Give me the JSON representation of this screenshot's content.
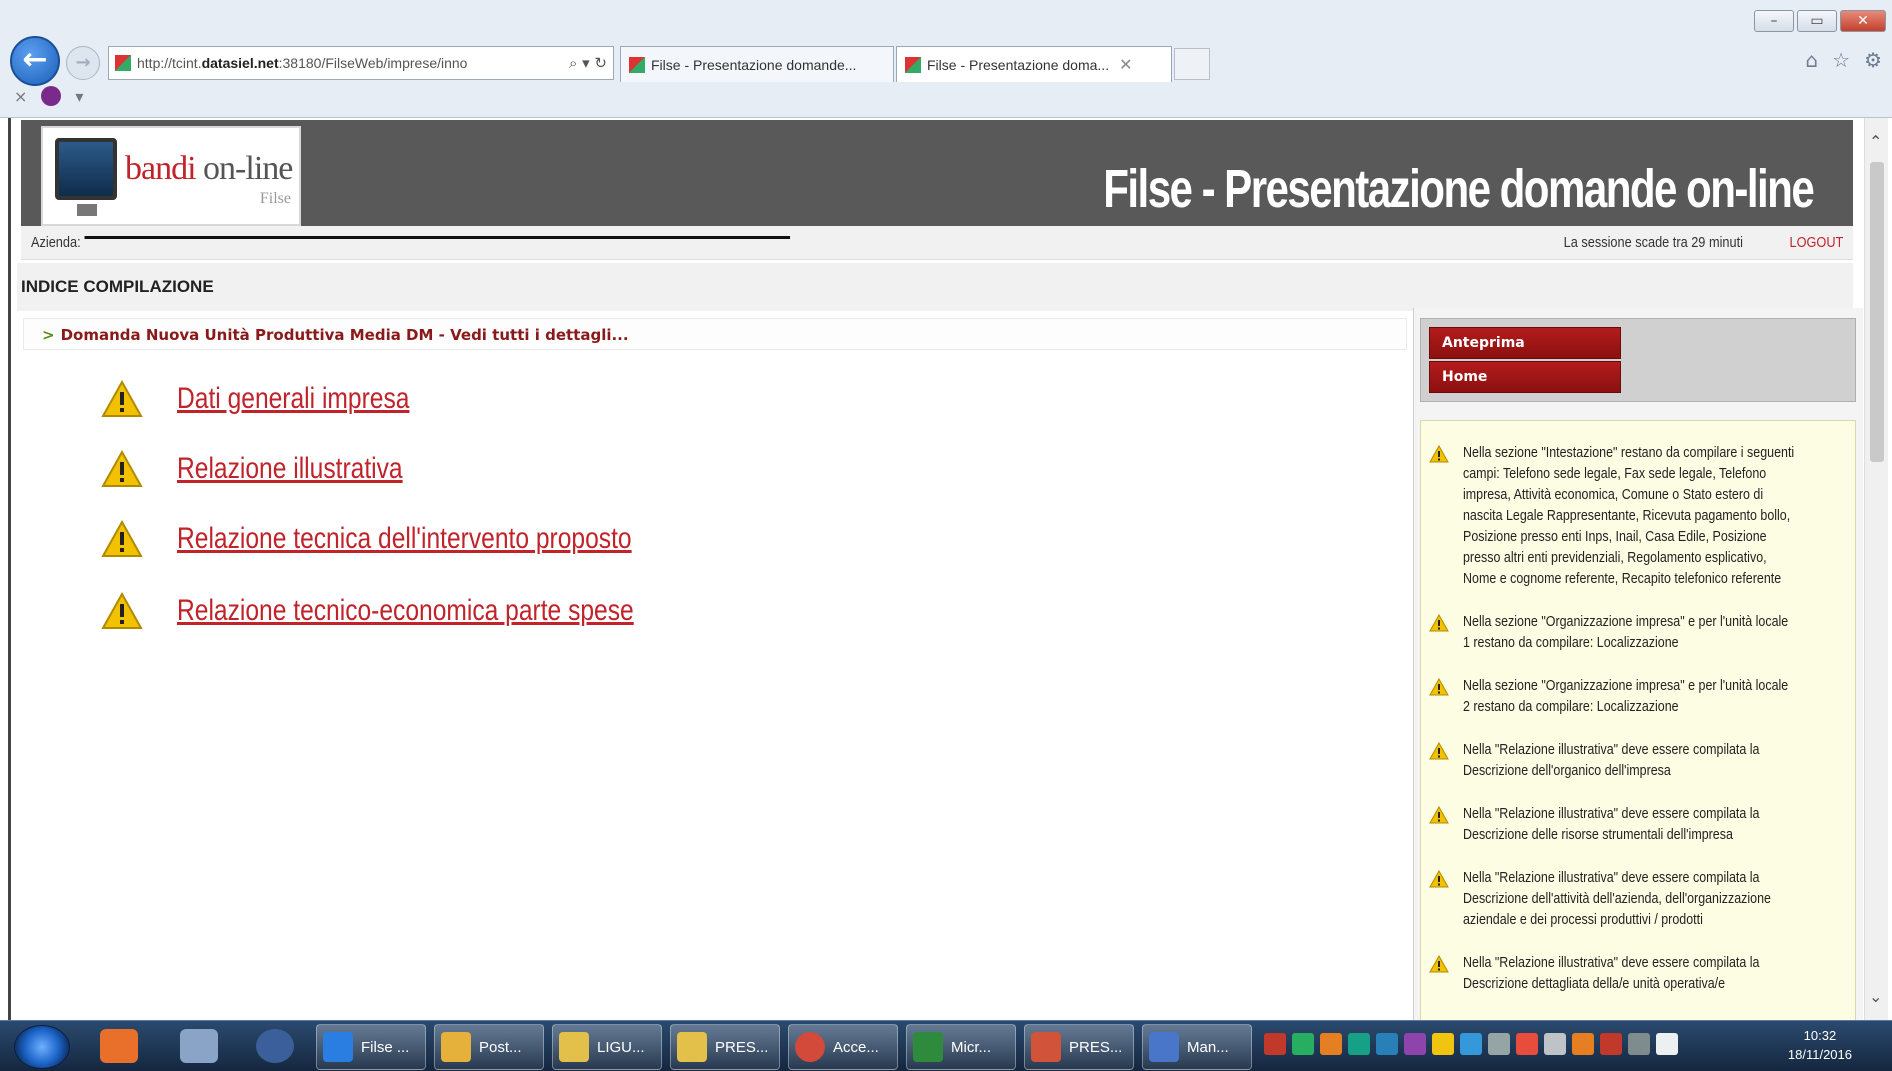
{
  "browser": {
    "url_prefix": "http://tcint.",
    "url_domain": "datasiel.net",
    "url_suffix": ":38180/FilseWeb/imprese/inno",
    "addr_icons": "⌕ ▾ ↻",
    "tabs": [
      {
        "label": "Filse - Presentazione domande..."
      },
      {
        "label": "Filse - Presentazione doma...",
        "close": "✕"
      }
    ],
    "right_icons": [
      "⌂",
      "☆",
      "⚙"
    ],
    "favbar_close": "×",
    "favbar_dropdown": "▾",
    "window_controls": [
      "–",
      "▭",
      "✕"
    ]
  },
  "header": {
    "logo_bandi": "bandi ",
    "logo_online": "on-line",
    "logo_sub": "Filse",
    "title": "Filse - Presentazione domande on-line"
  },
  "info": {
    "azienda_label": "Azienda:",
    "session": "La sessione scade tra 29 minuti",
    "logout": "LOGOUT"
  },
  "indice_title": "INDICE COMPILAZIONE",
  "breadcrumb": {
    "arrow": ">",
    "text": "Domanda Nuova Unità Produttiva Media DM - Vedi tutti i dettagli..."
  },
  "sections": [
    {
      "label": "Dati generali impresa"
    },
    {
      "label": "Relazione illustrativa"
    },
    {
      "label": "Relazione tecnica dell'intervento proposto"
    },
    {
      "label": "Relazione tecnico-economica parte spese"
    }
  ],
  "actions": {
    "preview": "Anteprima",
    "home": "Home"
  },
  "messages": [
    "Nella sezione \"Intestazione\" restano da compilare i seguenti campi: Telefono sede legale, Fax sede legale, Telefono impresa, Attività economica, Comune o Stato estero di nascita Legale Rappresentante, Ricevuta pagamento bollo, Posizione presso enti Inps, Inail, Casa Edile, Posizione presso altri enti previdenziali, Regolamento esplicativo, Nome e cognome referente, Recapito telefonico referente",
    "Nella sezione \"Organizzazione impresa\" e per l'unità locale 1 restano da compilare: Localizzazione",
    "Nella sezione \"Organizzazione impresa\" e per l'unità locale 2 restano da compilare: Localizzazione",
    "Nella \"Relazione illustrativa\" deve essere compilata la Descrizione dell'organico dell'impresa",
    "Nella \"Relazione illustrativa\" deve essere compilata la Descrizione delle risorse strumentali dell'impresa",
    "Nella \"Relazione illustrativa\" deve essere compilata la Descrizione dell'attività dell'azienda, dell'organizzazione aziendale e dei processi produttivi / prodotti",
    "Nella \"Relazione illustrativa\" deve essere compilata la Descrizione dettagliata della/e unità operativa/e"
  ],
  "scrollbar": {
    "up": "⌃",
    "down": "⌄"
  },
  "taskbar": {
    "buttons": [
      {
        "label": "Filse ...",
        "color": "#2a7de1"
      },
      {
        "label": "Post...",
        "color": "#e6b13a"
      },
      {
        "label": "LIGU...",
        "color": "#e2c04a"
      },
      {
        "label": "PRES...",
        "color": "#e2c04a"
      },
      {
        "label": "Acce...",
        "color": "#d44a3a"
      },
      {
        "label": "Micr...",
        "color": "#2e8b3e"
      },
      {
        "label": "PRES...",
        "color": "#d0533a"
      },
      {
        "label": "Man...",
        "color": "#4a76c9"
      }
    ],
    "clock_time": "10:32",
    "clock_date": "18/11/2016"
  },
  "colors": {
    "accent_red": "#c0232a",
    "header_gray": "#595959",
    "warning_yellow": "#f2c200",
    "message_bg": "#fdfde4"
  }
}
